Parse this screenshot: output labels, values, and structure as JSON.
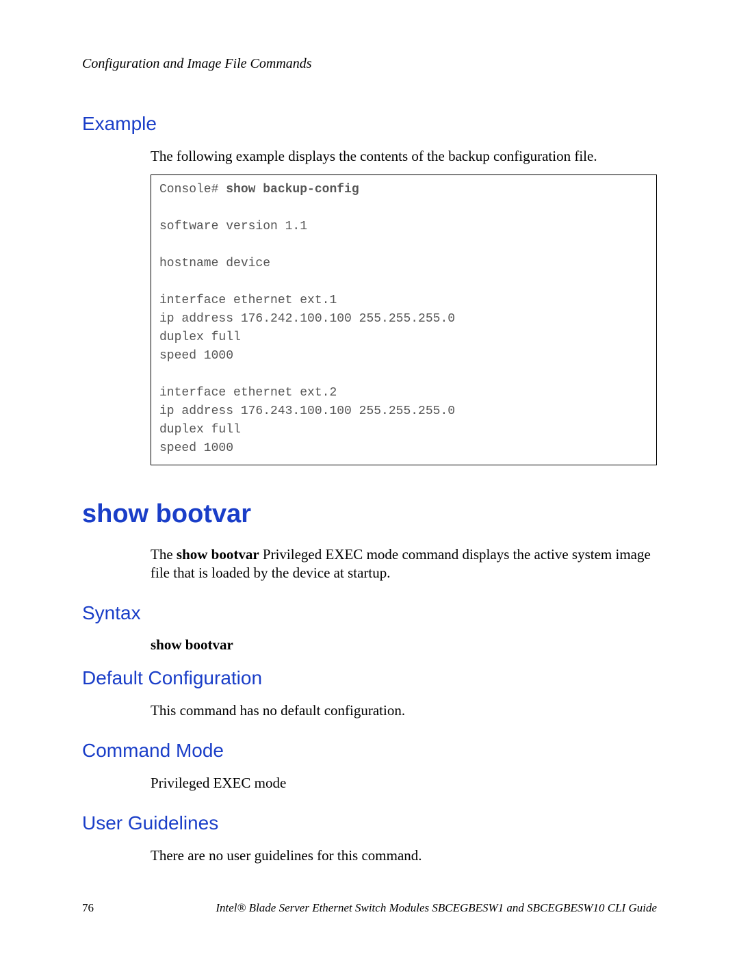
{
  "header": {
    "chapter": "Configuration and Image File Commands"
  },
  "example": {
    "heading": "Example",
    "intro": "The following example displays the contents of the backup configuration file.",
    "console_prompt": "Console# ",
    "console_cmd": "show backup-config",
    "output": "software version 1.1\n\nhostname device\n\ninterface ethernet ext.1\nip address 176.242.100.100 255.255.255.0\nduplex full\nspeed 1000\n\ninterface ethernet ext.2\nip address 176.243.100.100 255.255.255.0\nduplex full\nspeed 1000"
  },
  "command": {
    "title": "show bootvar",
    "desc_pre": "The ",
    "desc_bold": "show bootvar",
    "desc_post": " Privileged EXEC mode command displays the active system image file that is loaded by the device at startup."
  },
  "syntax": {
    "heading": "Syntax",
    "value": "show bootvar"
  },
  "defaultcfg": {
    "heading": "Default Configuration",
    "text": "This command has no default configuration."
  },
  "cmdmode": {
    "heading": "Command Mode",
    "text": "Privileged EXEC mode"
  },
  "guidelines": {
    "heading": "User Guidelines",
    "text": "There are no user guidelines for this command."
  },
  "footer": {
    "page": "76",
    "text": "Intel® Blade Server Ethernet Switch Modules SBCEGBESW1 and SBCEGBESW10 CLI Guide"
  }
}
